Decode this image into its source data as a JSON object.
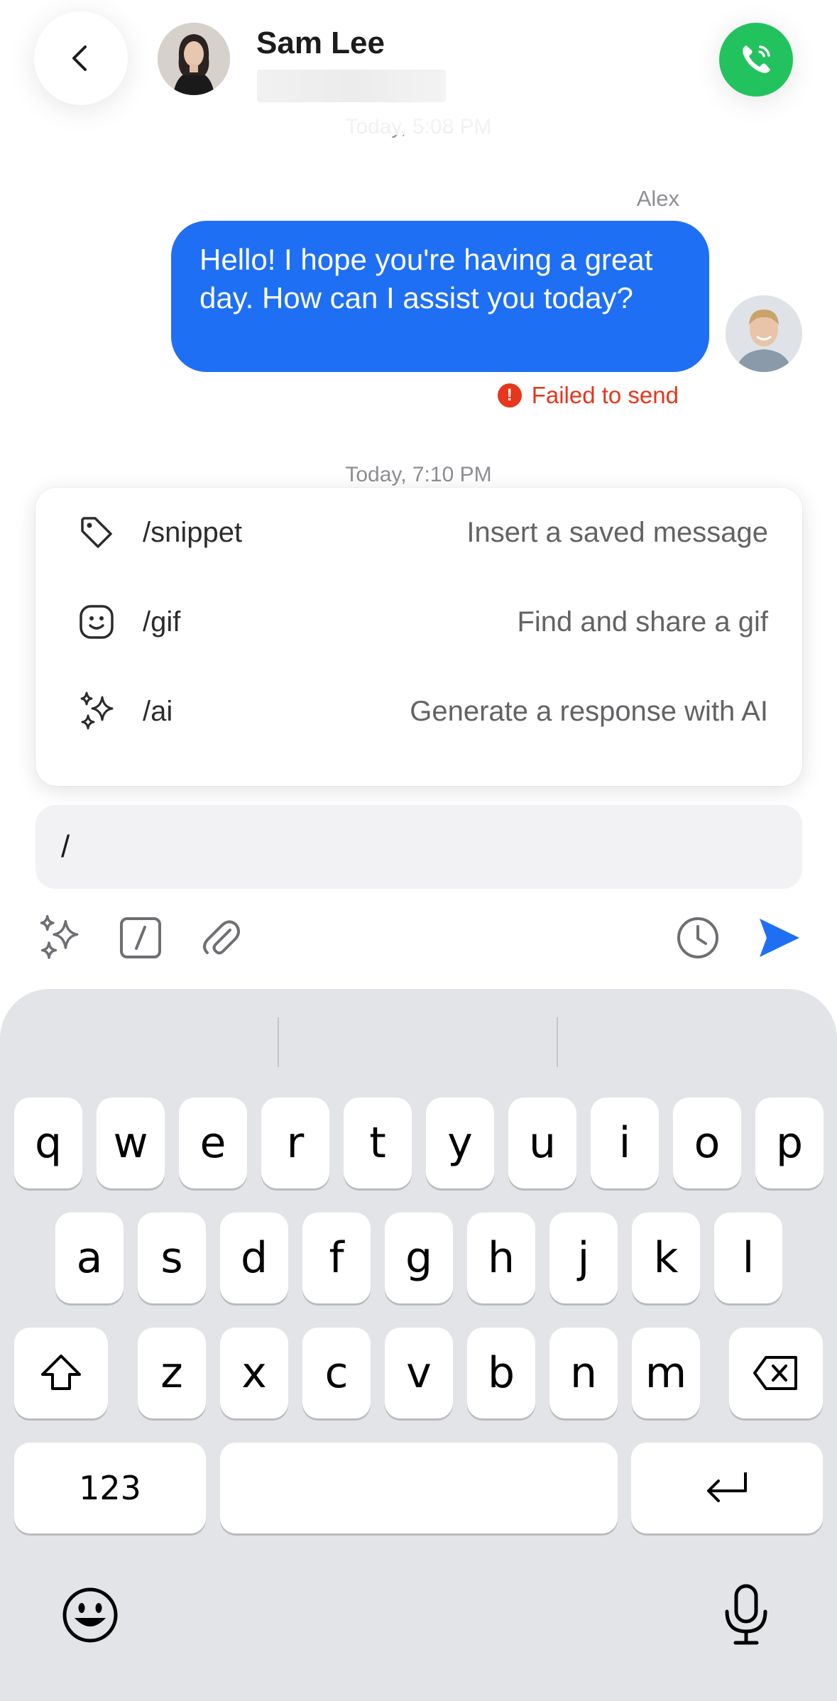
{
  "header": {
    "contact_name": "Sam Lee",
    "back_icon": "chevron-left-icon",
    "call_icon": "phone-call-icon",
    "call_color": "#22c35e"
  },
  "conversation": {
    "timestamp_1": "Today, 5:08 PM",
    "sender_name": "Alex",
    "message_text": "Hello! I hope you're having a great day. How can I assist you today?",
    "bubble_color": "#1f6ff5",
    "status_text": "Failed to send",
    "status_color": "#e6361c",
    "timestamp_2": "Today, 7:10 PM"
  },
  "command_menu": {
    "items": [
      {
        "icon": "tag-icon",
        "command": "/snippet",
        "description": "Insert a saved message"
      },
      {
        "icon": "smiley-icon",
        "command": "/gif",
        "description": "Find and share a gif"
      },
      {
        "icon": "sparkles-icon",
        "command": "/ai",
        "description": "Generate a response with AI"
      }
    ]
  },
  "composer": {
    "input_value": "/",
    "toolbar_icons": [
      "sparkles-icon",
      "slash-command-icon",
      "paperclip-icon",
      "clock-icon",
      "send-icon"
    ],
    "send_color": "#1f6ff5"
  },
  "keyboard": {
    "row1": [
      "q",
      "w",
      "e",
      "r",
      "t",
      "y",
      "u",
      "i",
      "o",
      "p"
    ],
    "row2": [
      "a",
      "s",
      "d",
      "f",
      "g",
      "h",
      "j",
      "k",
      "l"
    ],
    "row3": [
      "z",
      "x",
      "c",
      "v",
      "b",
      "n",
      "m"
    ],
    "numbers_key": "123",
    "bottom_icons": [
      "emoji-icon",
      "microphone-icon"
    ]
  }
}
